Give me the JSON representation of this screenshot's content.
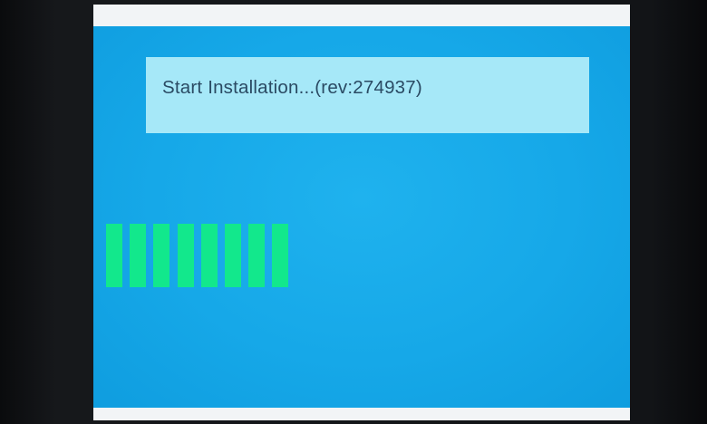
{
  "install": {
    "status_text": "Start Installation...(rev:274937)"
  },
  "progress": {
    "filled_segments": 8,
    "segment_color": "#12e88c"
  },
  "colors": {
    "background": "#16a8e8",
    "message_box": "#a6e8f8",
    "text": "#2a4a63"
  }
}
